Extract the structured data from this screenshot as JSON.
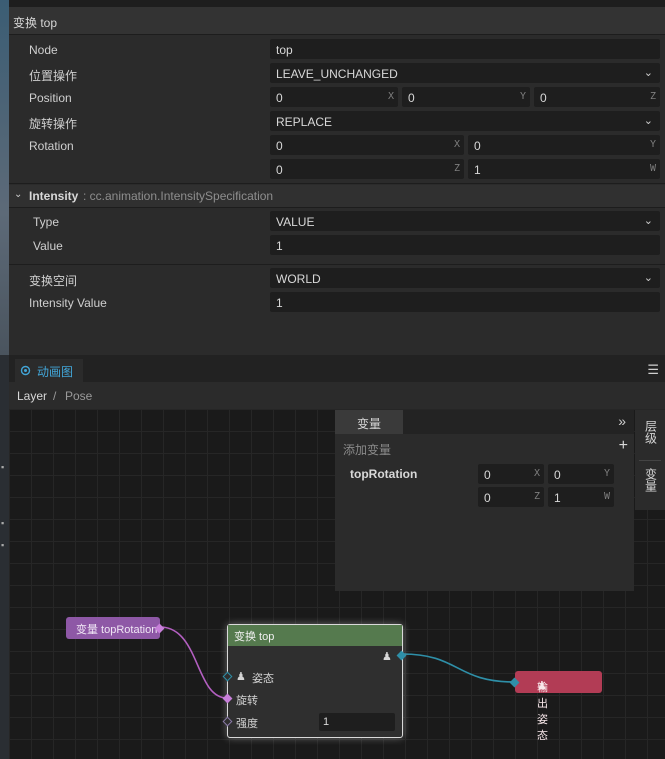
{
  "inspector": {
    "title": "变换 top",
    "rows": {
      "node_label": "Node",
      "node_value": "top",
      "pos_op_label": "位置操作",
      "pos_op_value": "LEAVE_UNCHANGED",
      "position_label": "Position",
      "position_x": "0",
      "position_y": "0",
      "position_z": "0",
      "rot_op_label": "旋转操作",
      "rot_op_value": "REPLACE",
      "rotation_label": "Rotation",
      "rotation_x": "0",
      "rotation_y": "0",
      "rotation_z": "0",
      "rotation_w": "1"
    },
    "axis": {
      "x": "X",
      "y": "Y",
      "z": "Z",
      "w": "W"
    },
    "intensity": {
      "title": "Intensity",
      "subtitle": ": cc.animation.IntensitySpecification",
      "type_label": "Type",
      "type_value": "VALUE",
      "value_label": "Value",
      "value_value": "1"
    },
    "space_label": "变换空间",
    "space_value": "WORLD",
    "intensity_value_label": "Intensity Value",
    "intensity_value_value": "1"
  },
  "tabs": {
    "anim_graph": "动画图"
  },
  "breadcrumb": {
    "layer": "Layer",
    "sep": "/",
    "pose": "Pose"
  },
  "variables": {
    "tab": "变量",
    "add": "添加变量",
    "name": "topRotation",
    "x": "0",
    "y": "0",
    "z": "0",
    "w": "1"
  },
  "side_tabs": {
    "layers": "层级",
    "vars": "变量"
  },
  "graph": {
    "var_node": "变量 topRotation",
    "transform_node": "变换 top",
    "pose_label": "姿态",
    "rotation_label": "旋转",
    "intensity_label": "强度",
    "intensity_value": "1",
    "output_node": "输出姿态"
  },
  "colors": {
    "accent": "#42a5d7",
    "var_node": "#8e58a6",
    "transform_header": "#557a4e",
    "output_node": "#b23c55",
    "pose_wire": "#2e8fa8",
    "var_wire": "#b35fc1"
  }
}
